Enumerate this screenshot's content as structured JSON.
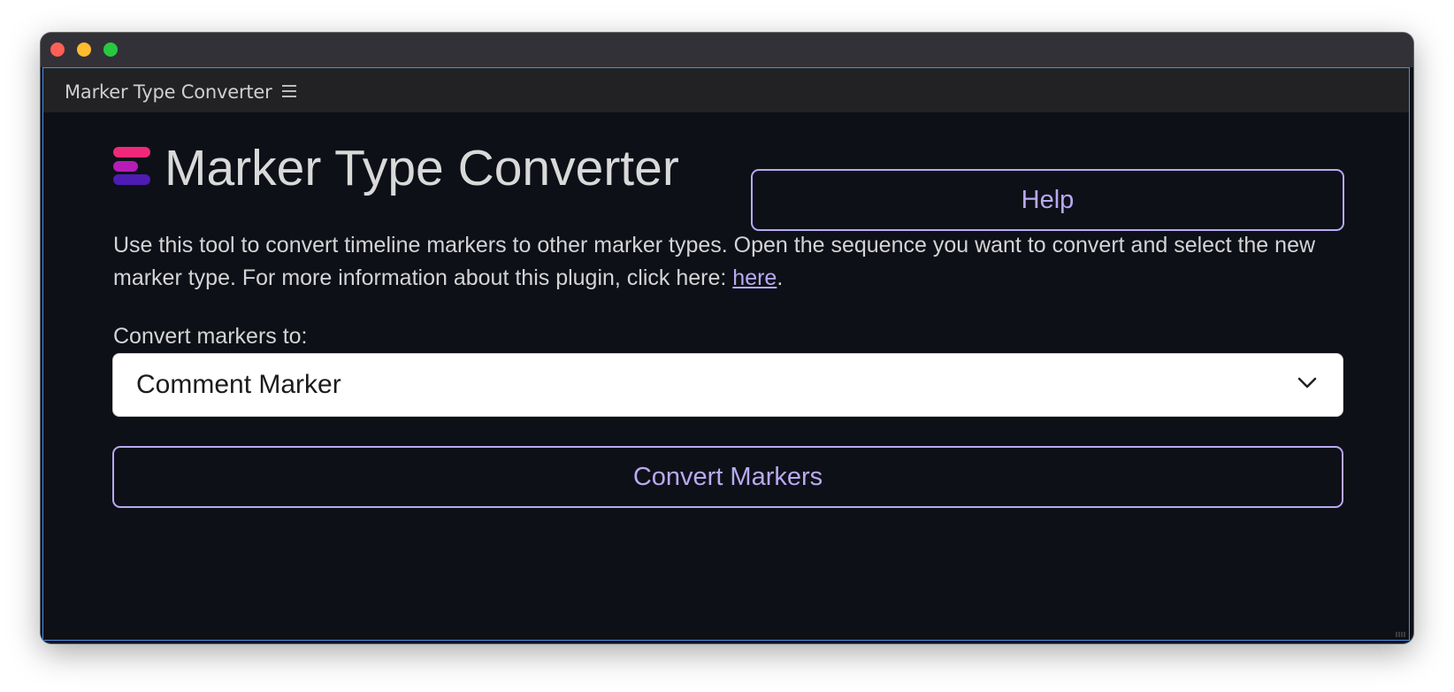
{
  "window": {
    "panel_title": "Marker Type Converter"
  },
  "app": {
    "title": "Marker Type Converter",
    "help_label": "Help",
    "description_text": "Use this tool to convert timeline markers to other marker types. Open the sequence you want to convert and select the new marker type. For more information about this plugin, click here: ",
    "description_link": "here",
    "description_end": ".",
    "select_label": "Convert markers to:",
    "selected_marker_type": "Comment Marker",
    "convert_label": "Convert Markers"
  },
  "icons": {
    "logo": "marker-stack-icon",
    "menu": "hamburger-icon",
    "dropdown": "chevron-down-icon"
  },
  "colors": {
    "accent": "#b9a9f0",
    "background": "#0e1018",
    "logo_top": "#f0287a",
    "logo_middle": "#b51db6",
    "logo_bottom": "#4e1cb3",
    "focus_border": "#4a8fe7"
  }
}
